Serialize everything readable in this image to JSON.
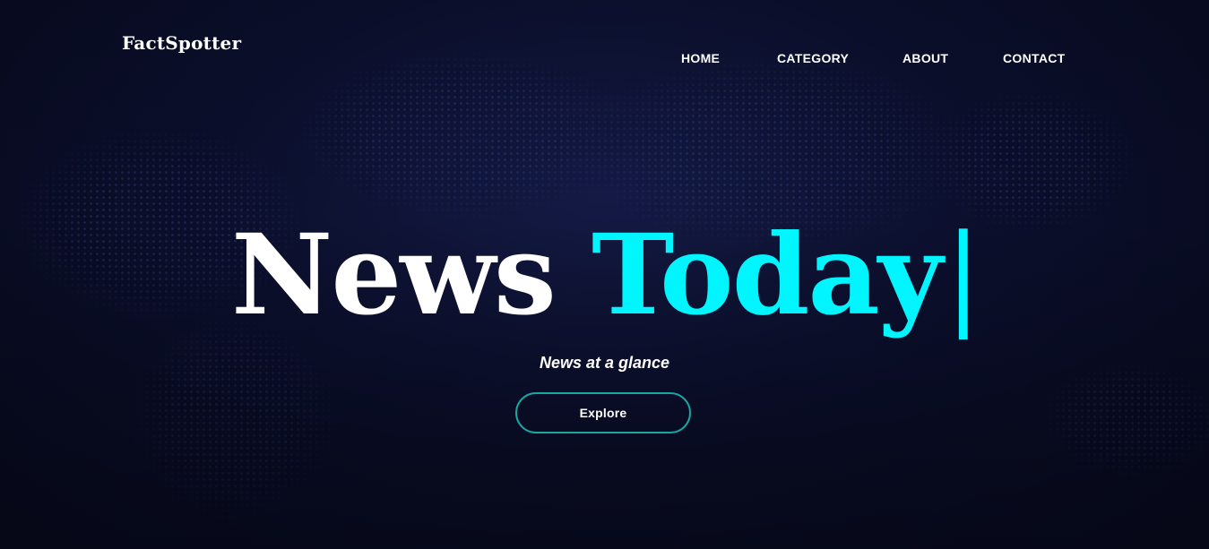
{
  "brand": {
    "name": "FactSpotter"
  },
  "nav": {
    "items": [
      {
        "label": "HOME"
      },
      {
        "label": "CATEGORY"
      },
      {
        "label": "ABOUT"
      },
      {
        "label": "CONTACT"
      }
    ]
  },
  "hero": {
    "headline_word_1": "News",
    "headline_word_2": "Today",
    "cursor": "|",
    "tagline": "News at a glance",
    "cta_label": "Explore"
  },
  "colors": {
    "background": "#070a1f",
    "accent_cyan": "#00f5ff",
    "button_border": "#17a6a2",
    "text": "#ffffff"
  }
}
